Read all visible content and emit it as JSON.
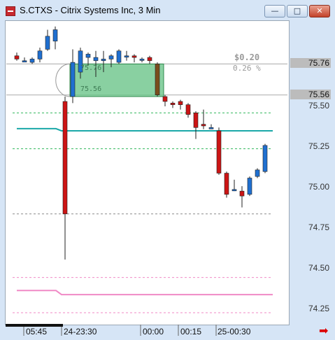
{
  "window": {
    "title": "S.CTXS - Citrix Systems Inc, 3 Min",
    "buttons": {
      "minimize": "—",
      "maximize": "□",
      "close": "✕"
    }
  },
  "position": {
    "entry_price": "75.76",
    "target_price": "75.56",
    "pnl_amount": "$0.20",
    "pnl_percent": "0.26 %",
    "entry_label": "75.76",
    "target_label": "75.56"
  },
  "yaxis": {
    "highlight_entry": "75.76",
    "highlight_target": "75.56",
    "ticks": [
      "75.50",
      "75.25",
      "75.00",
      "74.75",
      "74.50",
      "74.25"
    ]
  },
  "xaxis": {
    "labels": [
      "05:45",
      "24-23:30",
      "00:00",
      "00:15",
      "25-00:30"
    ]
  },
  "colors": {
    "up": "#1f6fd0",
    "down": "#cc1414",
    "box_fill": "#6cc489",
    "box_stroke": "#2f8a4d",
    "teal": "#1aa8a8",
    "green_dash": "#31b85b",
    "pink": "#f08ac6",
    "gray_line": "#8a8a8a"
  },
  "icons": {
    "app": "citrix-app-icon",
    "scroll_right": "red-arrow-right-icon"
  },
  "chart_data": {
    "type": "candlestick",
    "title": "S.CTXS - Citrix Systems Inc, 3 Min",
    "ylim": [
      74.16,
      76.17
    ],
    "candles": [
      {
        "o": 75.81,
        "h": 75.83,
        "l": 75.78,
        "c": 75.79
      },
      {
        "o": 75.78,
        "h": 75.8,
        "l": 75.78,
        "c": 75.78
      },
      {
        "o": 75.77,
        "h": 75.8,
        "l": 75.76,
        "c": 75.79
      },
      {
        "o": 75.79,
        "h": 75.86,
        "l": 75.77,
        "c": 75.84
      },
      {
        "o": 75.85,
        "h": 75.97,
        "l": 75.84,
        "c": 75.93
      },
      {
        "o": 75.9,
        "h": 75.99,
        "l": 75.85,
        "c": 75.97
      },
      {
        "o": 75.53,
        "h": 75.56,
        "l": 74.56,
        "c": 74.84
      },
      {
        "o": 75.56,
        "h": 75.85,
        "l": 75.52,
        "c": 75.77
      },
      {
        "o": 75.71,
        "h": 75.86,
        "l": 75.67,
        "c": 75.84
      },
      {
        "o": 75.8,
        "h": 75.83,
        "l": 75.75,
        "c": 75.82
      },
      {
        "o": 75.78,
        "h": 75.84,
        "l": 75.68,
        "c": 75.8
      },
      {
        "o": 75.78,
        "h": 75.84,
        "l": 75.71,
        "c": 75.79
      },
      {
        "o": 75.79,
        "h": 75.82,
        "l": 75.74,
        "c": 75.81
      },
      {
        "o": 75.77,
        "h": 75.85,
        "l": 75.76,
        "c": 75.84
      },
      {
        "o": 75.81,
        "h": 75.84,
        "l": 75.78,
        "c": 75.81
      },
      {
        "o": 75.81,
        "h": 75.82,
        "l": 75.77,
        "c": 75.8
      },
      {
        "o": 75.79,
        "h": 75.8,
        "l": 75.77,
        "c": 75.79
      },
      {
        "o": 75.8,
        "h": 75.81,
        "l": 75.76,
        "c": 75.78
      },
      {
        "o": 75.76,
        "h": 75.77,
        "l": 75.56,
        "c": 75.57
      },
      {
        "o": 75.56,
        "h": 75.57,
        "l": 75.5,
        "c": 75.53
      },
      {
        "o": 75.52,
        "h": 75.53,
        "l": 75.49,
        "c": 75.51
      },
      {
        "o": 75.53,
        "h": 75.54,
        "l": 75.48,
        "c": 75.51
      },
      {
        "o": 75.51,
        "h": 75.52,
        "l": 75.43,
        "c": 75.45
      },
      {
        "o": 75.46,
        "h": 75.47,
        "l": 75.3,
        "c": 75.37
      },
      {
        "o": 75.39,
        "h": 75.48,
        "l": 75.36,
        "c": 75.38
      },
      {
        "o": 75.37,
        "h": 75.39,
        "l": 75.36,
        "c": 75.37
      },
      {
        "o": 75.35,
        "h": 75.37,
        "l": 75.08,
        "c": 75.09
      },
      {
        "o": 75.09,
        "h": 75.1,
        "l": 74.94,
        "c": 74.96
      },
      {
        "o": 74.99,
        "h": 75.05,
        "l": 74.98,
        "c": 74.99
      },
      {
        "o": 74.98,
        "h": 75.01,
        "l": 74.88,
        "c": 74.95
      },
      {
        "o": 74.96,
        "h": 75.07,
        "l": 74.95,
        "c": 75.06
      },
      {
        "o": 75.07,
        "h": 75.12,
        "l": 75.06,
        "c": 75.11
      },
      {
        "o": 75.1,
        "h": 75.27,
        "l": 75.09,
        "c": 75.26
      }
    ]
  }
}
